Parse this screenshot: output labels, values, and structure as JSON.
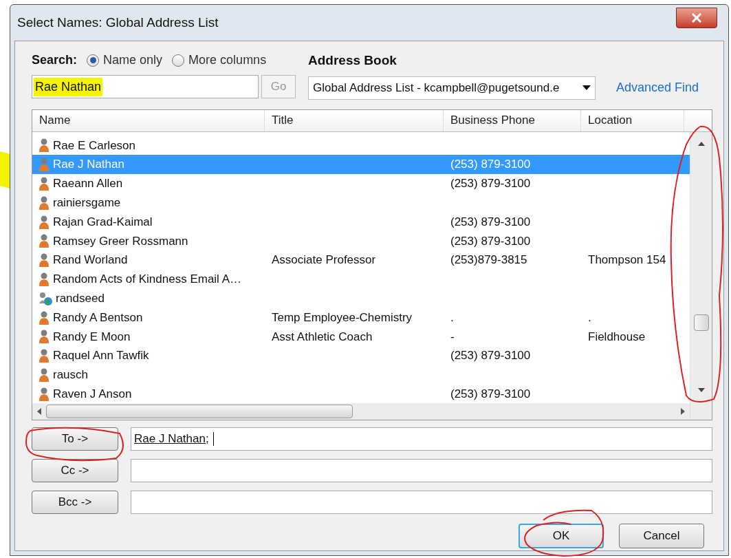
{
  "window": {
    "title": "Select Names: Global Address List"
  },
  "search": {
    "label": "Search:",
    "options": [
      {
        "label": "Name only",
        "selected": true
      },
      {
        "label": "More columns",
        "selected": false
      }
    ],
    "value": "Rae Nathan",
    "highlighted": true,
    "go": "Go"
  },
  "address_book": {
    "label": "Address Book",
    "value": "Global Address List - kcampbell@pugetsound.e",
    "advanced_find": "Advanced Find"
  },
  "table": {
    "columns": [
      "Name",
      "Title",
      "Business Phone",
      "Location"
    ],
    "rows": [
      {
        "kind": "person",
        "selected": false,
        "cells": [
          "Rae E Carleson",
          "",
          "",
          ""
        ]
      },
      {
        "kind": "person",
        "selected": true,
        "cells": [
          "Rae J Nathan",
          "",
          "(253) 879-3100",
          ""
        ]
      },
      {
        "kind": "person",
        "selected": false,
        "cells": [
          "Raeann Allen",
          "",
          "(253) 879-3100",
          ""
        ]
      },
      {
        "kind": "person",
        "selected": false,
        "cells": [
          "rainiersgame",
          "",
          "",
          ""
        ]
      },
      {
        "kind": "person",
        "selected": false,
        "cells": [
          "Rajan Grad-Kaimal",
          "",
          "(253) 879-3100",
          ""
        ]
      },
      {
        "kind": "person",
        "selected": false,
        "cells": [
          "Ramsey Greer Rossmann",
          "",
          "(253) 879-3100",
          ""
        ]
      },
      {
        "kind": "person",
        "selected": false,
        "cells": [
          "Rand Worland",
          "Associate Professor",
          "(253)879-3815",
          "Thompson 154"
        ]
      },
      {
        "kind": "person",
        "selected": false,
        "cells": [
          "Random Acts of Kindness Email A…",
          "",
          "",
          ""
        ]
      },
      {
        "kind": "public-folder",
        "selected": false,
        "cells": [
          "randseed",
          "",
          "",
          ""
        ]
      },
      {
        "kind": "person",
        "selected": false,
        "cells": [
          "Randy A Bentson",
          "Temp Employee-Chemistry",
          ".",
          "."
        ]
      },
      {
        "kind": "person",
        "selected": false,
        "cells": [
          "Randy E Moon",
          "Asst Athletic Coach",
          "-",
          "Fieldhouse"
        ]
      },
      {
        "kind": "person",
        "selected": false,
        "cells": [
          "Raquel Ann Tawfik",
          "",
          "(253) 879-3100",
          ""
        ]
      },
      {
        "kind": "person",
        "selected": false,
        "cells": [
          "rausch",
          "",
          "",
          ""
        ]
      },
      {
        "kind": "person",
        "selected": false,
        "cells": [
          "Raven J Anson",
          "",
          "(253) 879-3100",
          ""
        ]
      }
    ]
  },
  "recipients": [
    {
      "label": "To ->",
      "value": "Rae J Nathan;"
    },
    {
      "label": "Cc ->"
    },
    {
      "label": "Bcc ->"
    }
  ],
  "buttons": [
    {
      "label": "OK",
      "default": true
    },
    {
      "label": "Cancel",
      "default": false
    }
  ]
}
